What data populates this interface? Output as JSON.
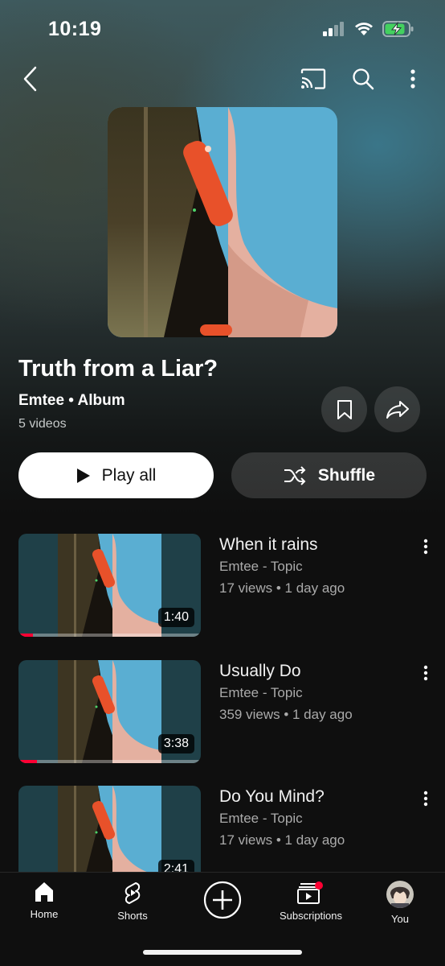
{
  "status": {
    "time": "10:19"
  },
  "album": {
    "title": "Truth from a Liar?",
    "meta": "Emtee • Album",
    "count": "5 videos"
  },
  "actions": {
    "play_all": "Play all",
    "shuffle": "Shuffle"
  },
  "videos": [
    {
      "title": "When it rains",
      "channel": "Emtee - Topic",
      "meta": "17 views • 1 day ago",
      "duration": "1:40",
      "progress": 0.08
    },
    {
      "title": "Usually Do",
      "channel": "Emtee - Topic",
      "meta": "359 views • 1 day ago",
      "duration": "3:38",
      "progress": 0.1
    },
    {
      "title": "Do You Mind?",
      "channel": "Emtee - Topic",
      "meta": "17 views • 1 day ago",
      "duration": "2:41",
      "progress": 0
    }
  ],
  "nav": {
    "home": "Home",
    "shorts": "Shorts",
    "subscriptions": "Subscriptions",
    "you": "You"
  },
  "colors": {
    "accent": "#ff0033",
    "background": "#0f0f0f"
  },
  "icons": [
    "back-icon",
    "cast-icon",
    "search-icon",
    "more-vert-icon",
    "bookmark-icon",
    "share-icon",
    "play-icon",
    "shuffle-icon",
    "home-icon",
    "shorts-icon",
    "create-icon",
    "subscriptions-icon",
    "avatar"
  ]
}
